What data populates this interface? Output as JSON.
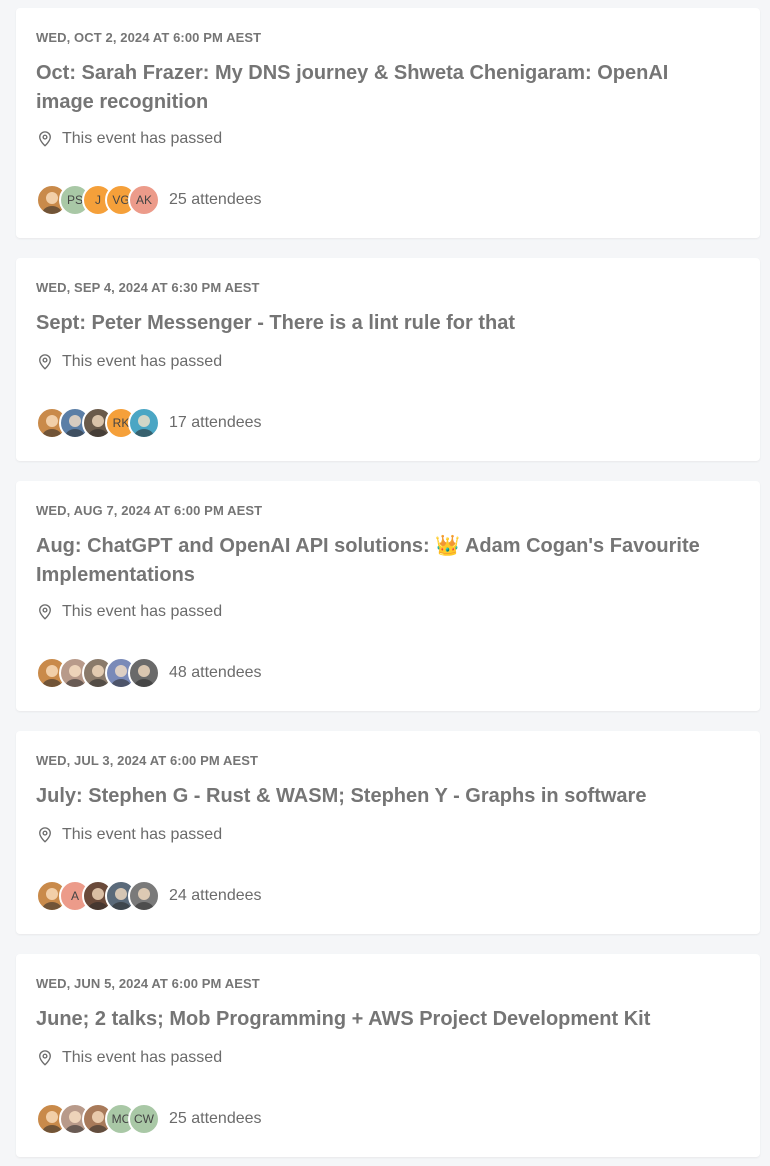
{
  "events": [
    {
      "date": "WED, OCT 2, 2024 AT 6:00 PM AEST",
      "title": "Oct: Sarah Frazer: My DNS journey & Shweta Chenigaram: OpenAI image recognition",
      "location": "This event has passed",
      "attendees": "25 attendees",
      "avatars": [
        {
          "initials": "",
          "color": "#c98a4a"
        },
        {
          "initials": "PS",
          "color": "#a9c8a6"
        },
        {
          "initials": "J",
          "color": "#f5a03a"
        },
        {
          "initials": "VG",
          "color": "#f5a03a"
        },
        {
          "initials": "AK",
          "color": "#ec9b8a"
        }
      ]
    },
    {
      "date": "WED, SEP 4, 2024 AT 6:30 PM AEST",
      "title": "Sept: Peter Messenger - There is a lint rule for that",
      "location": "This event has passed",
      "attendees": "17 attendees",
      "avatars": [
        {
          "initials": "",
          "color": "#c98a4a"
        },
        {
          "initials": "",
          "color": "#5b7ea6"
        },
        {
          "initials": "",
          "color": "#6a5a4a"
        },
        {
          "initials": "RK",
          "color": "#f5a03a"
        },
        {
          "initials": "",
          "color": "#4ba6c4"
        }
      ]
    },
    {
      "date": "WED, AUG 7, 2024 AT 6:00 PM AEST",
      "title": "Aug: ChatGPT and OpenAI API solutions: 👑 Adam Cogan's Favourite Implementations",
      "location": "This event has passed",
      "attendees": "48 attendees",
      "avatars": [
        {
          "initials": "",
          "color": "#c98a4a"
        },
        {
          "initials": "",
          "color": "#b89a8a"
        },
        {
          "initials": "",
          "color": "#8a7a6a"
        },
        {
          "initials": "",
          "color": "#7a8ab8"
        },
        {
          "initials": "",
          "color": "#6a6a6a"
        }
      ]
    },
    {
      "date": "WED, JUL 3, 2024 AT 6:00 PM AEST",
      "title": "July: Stephen G - Rust & WASM; Stephen Y - Graphs in software",
      "location": "This event has passed",
      "attendees": "24 attendees",
      "avatars": [
        {
          "initials": "",
          "color": "#c98a4a"
        },
        {
          "initials": "A",
          "color": "#ec9b8a"
        },
        {
          "initials": "",
          "color": "#6a4a3a"
        },
        {
          "initials": "",
          "color": "#5a6a7a"
        },
        {
          "initials": "",
          "color": "#7a7a7a"
        }
      ]
    },
    {
      "date": "WED, JUN 5, 2024 AT 6:00 PM AEST",
      "title": "June; 2 talks; Mob Programming + AWS Project Development Kit",
      "location": "This event has passed",
      "attendees": "25 attendees",
      "avatars": [
        {
          "initials": "",
          "color": "#c98a4a"
        },
        {
          "initials": "",
          "color": "#b89a8a"
        },
        {
          "initials": "",
          "color": "#a87a5a"
        },
        {
          "initials": "MC",
          "color": "#a9c8a6"
        },
        {
          "initials": "CW",
          "color": "#a9c8a6"
        }
      ]
    }
  ]
}
